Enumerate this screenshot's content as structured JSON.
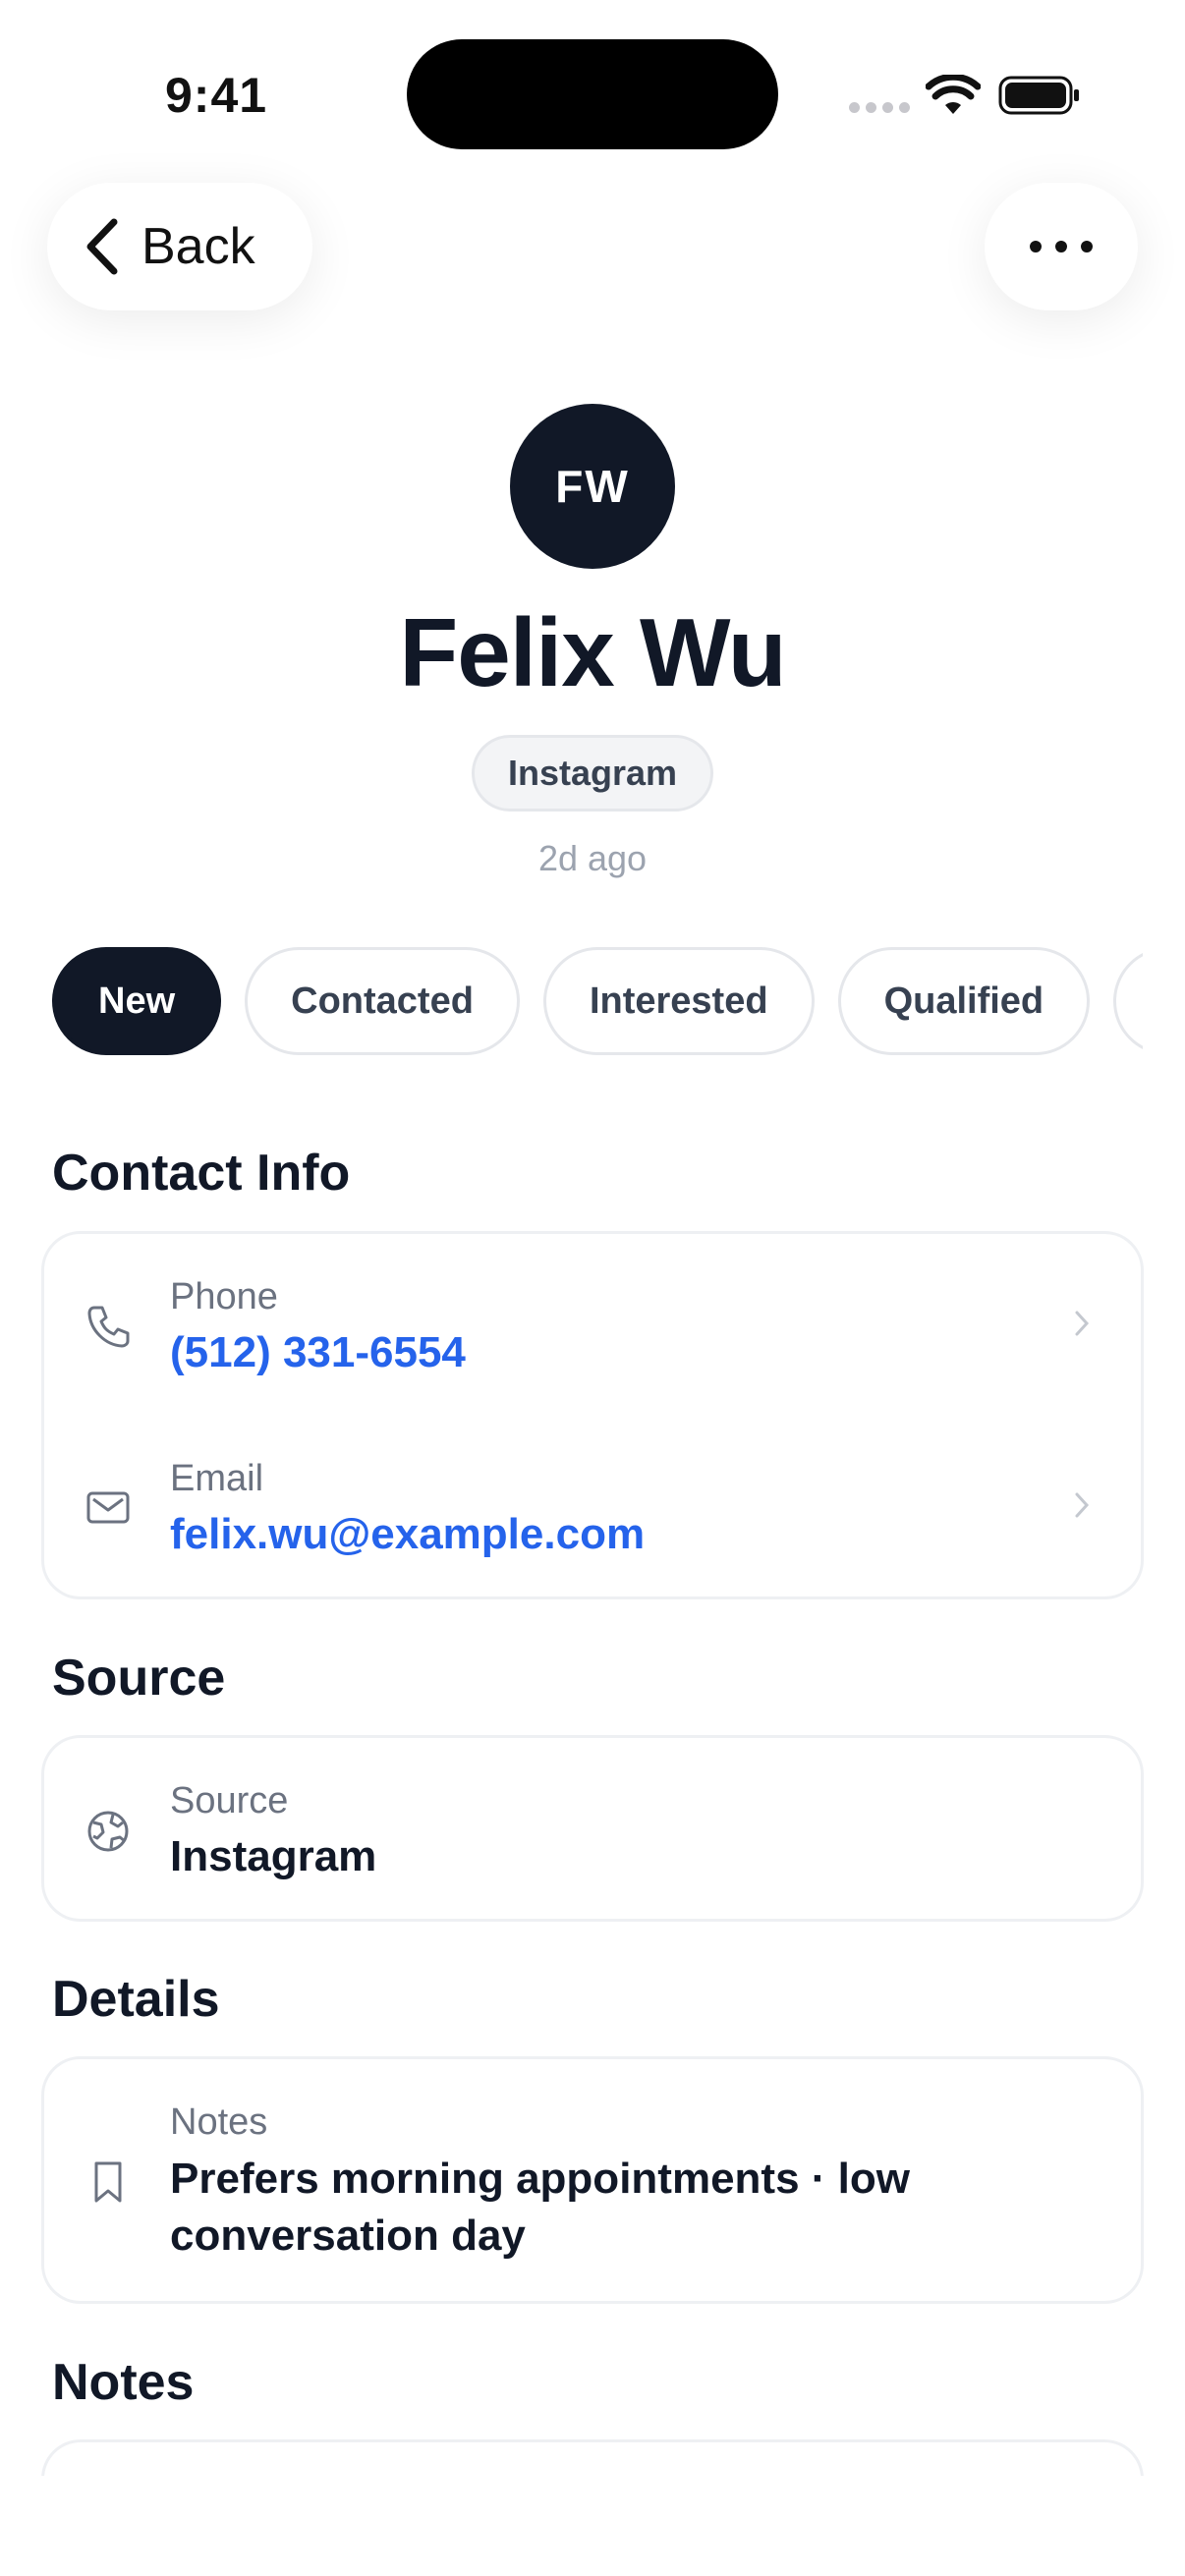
{
  "status_bar": {
    "time": "9:41"
  },
  "nav": {
    "back_label": "Back"
  },
  "profile": {
    "initials": "FW",
    "name": "Felix Wu",
    "source_badge": "Instagram",
    "time_ago": "2d ago"
  },
  "status_pills": [
    {
      "label": "New",
      "active": true
    },
    {
      "label": "Contacted",
      "active": false
    },
    {
      "label": "Interested",
      "active": false
    },
    {
      "label": "Qualified",
      "active": false
    }
  ],
  "contact_info": {
    "title": "Contact Info",
    "phone": {
      "label": "Phone",
      "value": "(512) 331-6554"
    },
    "email": {
      "label": "Email",
      "value": "felix.wu@example.com"
    }
  },
  "source_section": {
    "title": "Source",
    "source": {
      "label": "Source",
      "value": "Instagram"
    }
  },
  "details": {
    "title": "Details",
    "notes": {
      "label": "Notes",
      "value": "Prefers morning appointments · low conversation day"
    }
  },
  "notes_section": {
    "title": "Notes"
  },
  "colors": {
    "accent": "#111827",
    "link": "#2563eb",
    "muted": "#6b7280"
  }
}
